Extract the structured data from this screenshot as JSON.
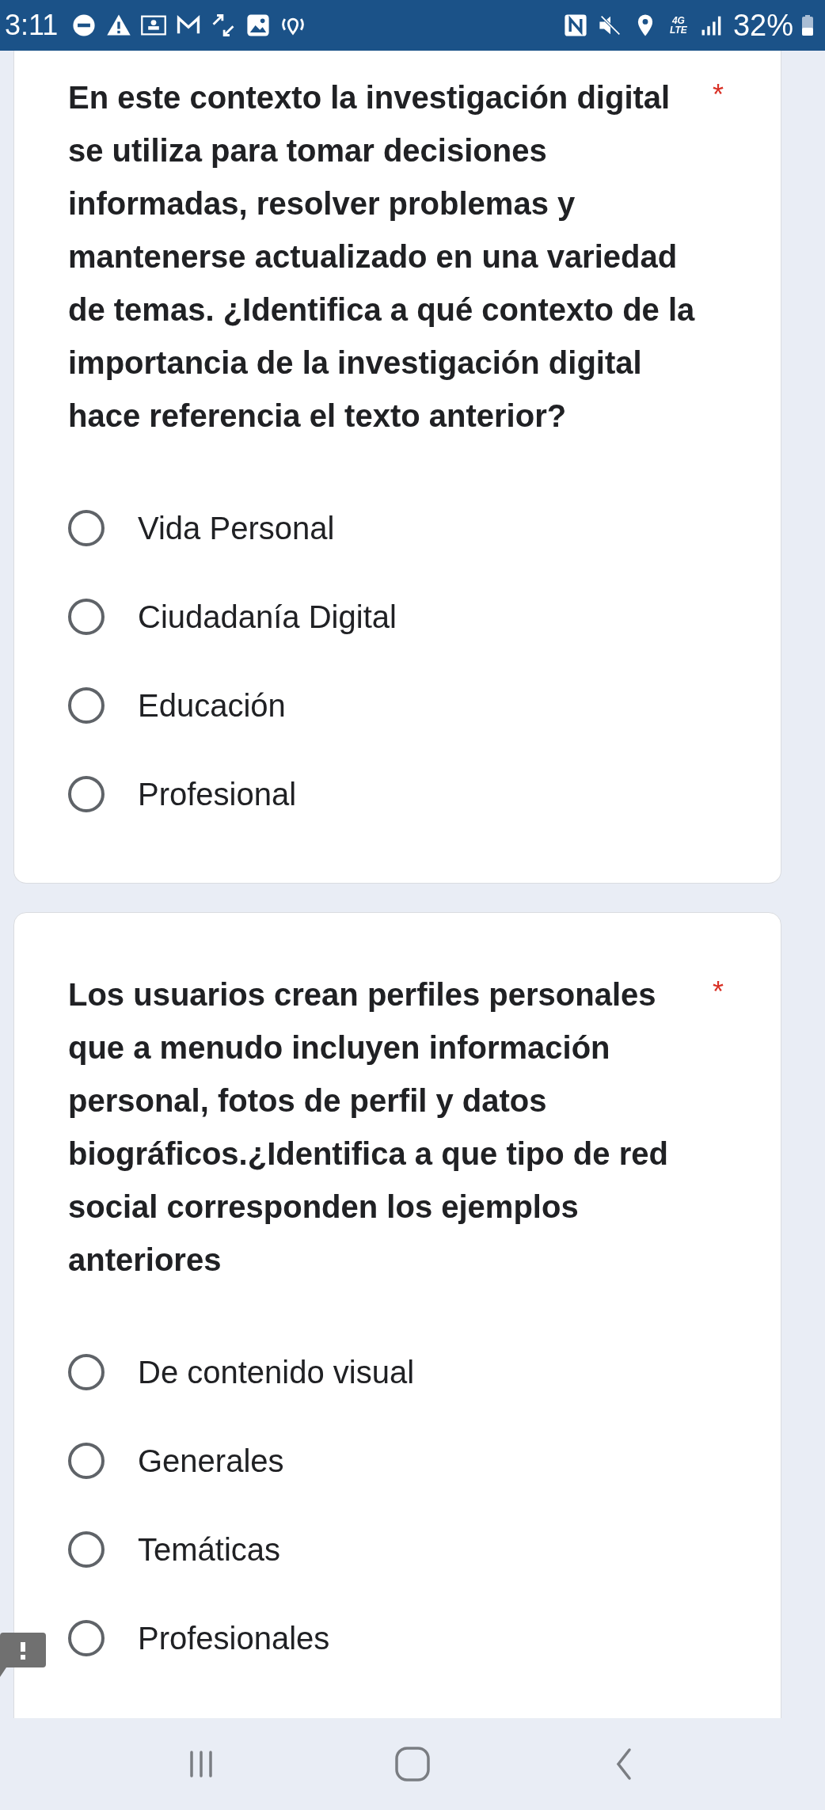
{
  "status_bar": {
    "time": "3:11",
    "network": "4G LTE",
    "battery": "32%"
  },
  "questions": [
    {
      "text": "En este contexto la investigación digital se utiliza para tomar decisiones informadas, resolver problemas y mantenerse actualizado en una variedad de temas. ¿Identifica a qué contexto de la importancia de la investigación digital hace referencia el texto anterior?",
      "required_mark": "*",
      "options": [
        {
          "label": "Vida Personal",
          "selected": false
        },
        {
          "label": "Ciudadanía Digital",
          "selected": false
        },
        {
          "label": "Educación",
          "selected": false
        },
        {
          "label": "Profesional",
          "selected": false
        }
      ]
    },
    {
      "text": "Los usuarios crean perfiles personales que a menudo incluyen información personal, fotos de perfil y datos biográficos.¿Identifica a que tipo de red social corresponden los ejemplos anteriores",
      "required_mark": "*",
      "options": [
        {
          "label": "De contenido visual",
          "selected": false
        },
        {
          "label": "Generales",
          "selected": false
        },
        {
          "label": "Temáticas",
          "selected": false
        },
        {
          "label": "Profesionales",
          "selected": false
        }
      ]
    }
  ]
}
